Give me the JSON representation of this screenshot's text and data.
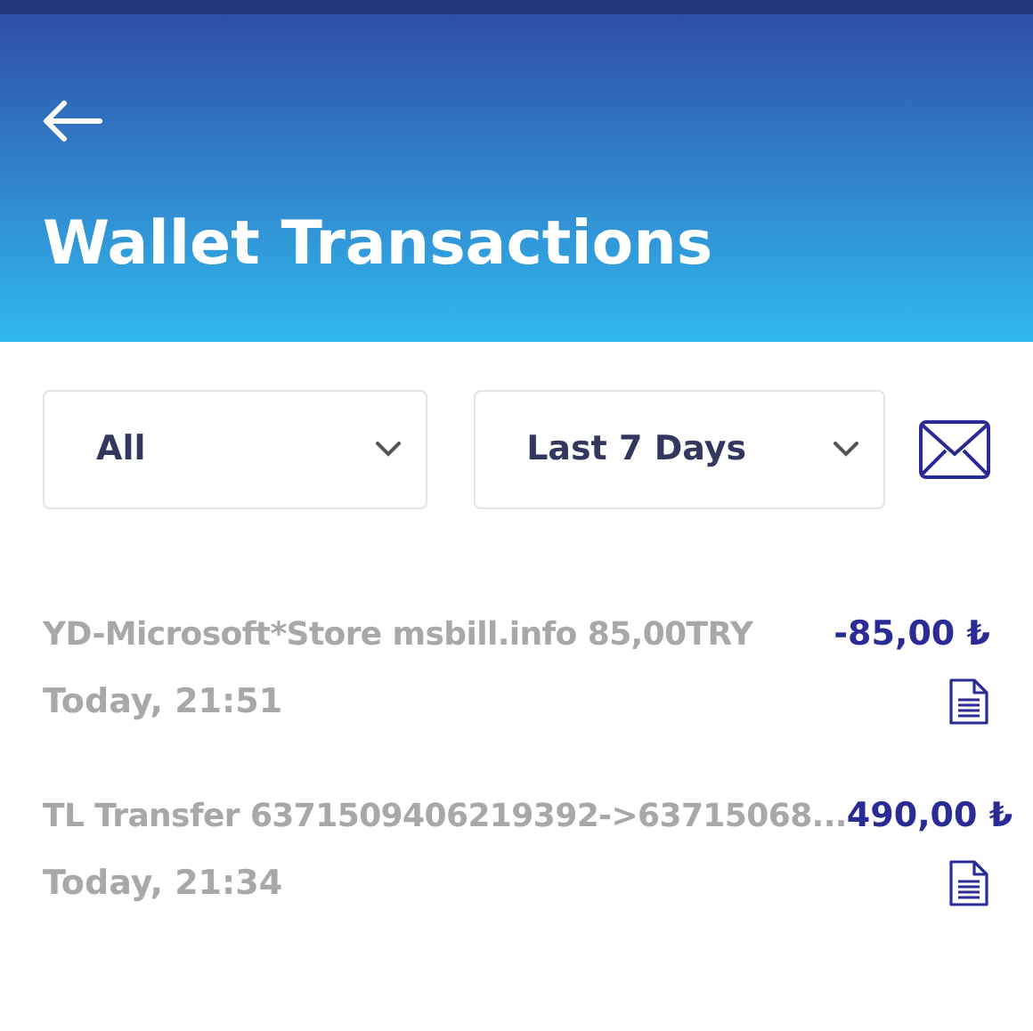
{
  "header": {
    "title": "Wallet Transactions"
  },
  "filters": [
    {
      "value": "All"
    },
    {
      "value": "Last 7 Days"
    }
  ],
  "transactions": [
    {
      "description": "YD-Microsoft*Store msbill.info 85,00TRY",
      "time": "Today, 21:51",
      "amount": "-85,00 ₺"
    },
    {
      "description": "TL Transfer 6371509406219392->63715068...",
      "time": "Today, 21:34",
      "amount": "490,00 ₺"
    }
  ]
}
